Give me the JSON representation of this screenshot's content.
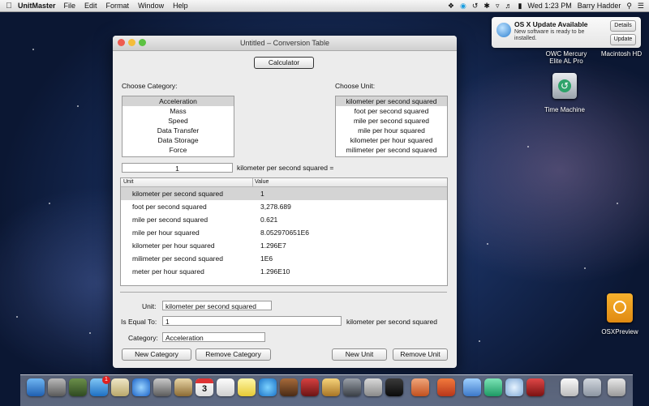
{
  "menubar": {
    "app_name": "UnitMaster",
    "menus": [
      "File",
      "Edit",
      "Format",
      "Window",
      "Help"
    ],
    "clock": "Wed 1:23 PM",
    "user": "Barry Hadder"
  },
  "notification": {
    "title": "OS X Update Available",
    "body": "New software is ready to be installed.",
    "details_label": "Details",
    "update_label": "Update"
  },
  "desktop": {
    "icons": [
      {
        "name": "OWC Mercury Elite AL Pro"
      },
      {
        "name": "Macintosh HD"
      },
      {
        "name": "Time Machine"
      },
      {
        "name": "OSXPreview"
      }
    ]
  },
  "window": {
    "title": "Untitled – Conversion Table",
    "calculator_label": "Calculator",
    "choose_category_label": "Choose Category:",
    "choose_unit_label": "Choose Unit:",
    "categories": [
      "Acceleration",
      "Mass",
      "Speed",
      "Data Transfer",
      "Data Storage",
      "Force"
    ],
    "units": [
      "kilometer per second squared",
      "foot per second squared",
      "mile per second squared",
      "mile per hour squared",
      "kilometer per hour squared",
      "milimeter per second squared"
    ],
    "input_value": "1",
    "input_unit_text": "kilometer per second squared =",
    "table": {
      "columns": [
        "Unit",
        "Value"
      ],
      "rows": [
        {
          "unit": "kilometer per second squared",
          "value": "1"
        },
        {
          "unit": "foot per second squared",
          "value": "3,278.689"
        },
        {
          "unit": "mile per second squared",
          "value": "0.621"
        },
        {
          "unit": "mile per hour squared",
          "value": "8.052970651E6"
        },
        {
          "unit": "kilometer per hour squared",
          "value": "1.296E7"
        },
        {
          "unit": "milimeter per second squared",
          "value": "1E6"
        },
        {
          "unit": "meter per hour squared",
          "value": "1.296E10"
        }
      ]
    },
    "form": {
      "unit_label": "Unit:",
      "unit_value": "kilometer per second squared",
      "equal_label": "Is Equal To:",
      "equal_value": "1",
      "equal_unit": "kilometer per second squared",
      "category_label": "Category:",
      "category_value": "Acceleration"
    },
    "buttons": {
      "new_category": "New Category",
      "remove_category": "Remove Category",
      "new_unit": "New Unit",
      "remove_unit": "Remove Unit"
    }
  },
  "dock": {
    "calendar_day": "3",
    "app_store_badge": "1"
  },
  "colors": {
    "selection_gray": "#d4d4d4",
    "window_bg": "#ececec",
    "desktop_blue": "#1e3566",
    "close": "#ee5b50",
    "minimize": "#f5bd3b",
    "zoom": "#5cc242"
  }
}
